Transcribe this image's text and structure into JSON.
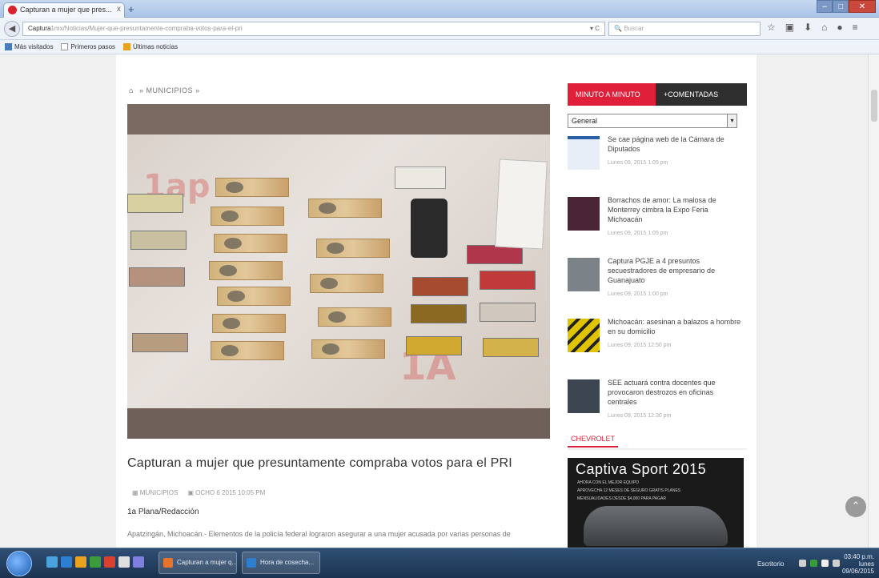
{
  "browser": {
    "tab_title": "Capturan a mujer que pres...",
    "tab_close": "x",
    "new_tab": "+",
    "window_controls": {
      "minimize": "–",
      "maximize": "□",
      "close": "✕"
    },
    "url_domain": "Captura",
    "url_rest": "1mx/Noticias/Mujer-que-presuntamente-compraba-votos-para-el-pri",
    "url_controls": "▾ C",
    "search_placeholder": "Buscar",
    "toolbar_icons": [
      "star-icon",
      "clipboard-icon",
      "download-icon",
      "home-icon",
      "chat-icon",
      "menu-icon"
    ],
    "bookmarks": [
      {
        "label": "Más visitados",
        "icon": "bookmark-star-icon",
        "color": "#4a7cc0"
      },
      {
        "label": "Primeros pasos",
        "icon": "page-icon",
        "color": "#ffffff"
      },
      {
        "label": "Últimas noticias",
        "icon": "rss-icon",
        "color": "#e8a21e"
      }
    ]
  },
  "page": {
    "breadcrumb": {
      "home": "⌂",
      "trail": "» MUNICIPIOS »"
    },
    "article": {
      "title": "Capturan a mujer que presuntamente compraba votos para el PRI",
      "meta_category": "MUNICIPIOS",
      "meta_date": "OCHO 6 2015 10:05 PM",
      "author": "1a Plana/Redacción",
      "body": "Apatzingán, Michoacán.- Elementos de la policía federal lograron asegurar a una mujer acusada por varias personas de"
    },
    "watermark": "1A",
    "watermark2": "1ap",
    "sidebar": {
      "tab_active": "MINUTO A MINUTO",
      "tab_inactive": "+COMENTADAS",
      "select_value": "General",
      "select_arrow": "▾",
      "news": [
        {
          "title": "Se cae página web de la Cámara de Diputados",
          "date": "Lunes 09, 2015 1:05 pm",
          "thumb": "#e8eef7"
        },
        {
          "title": "Borrachos de amor: La malosa de Monterrey cimbra la Expo Feria Michoacán",
          "date": "Lunes 09, 2015 1:05 pm",
          "thumb": "#4a2536"
        },
        {
          "title": "Captura PGJE a 4 presuntos secuestradores de empresario de Guanajuato",
          "date": "Lunes 09, 2015 1:00 pm",
          "thumb": "#7b8288"
        },
        {
          "title": "Michoacán: asesinan a balazos a hombre en su domicilio",
          "date": "Lunes 09, 2015 12:50 pm",
          "thumb": "#c7b300"
        },
        {
          "title": "SEE actuará contra docentes que provocaron destrozos en oficinas centrales",
          "date": "Lunes 09, 2015 12:30 pm",
          "thumb": "#3d4650"
        }
      ]
    },
    "sponsor_section": "CHEVROLET",
    "ad": {
      "title": "Captiva Sport 2015",
      "line1": "AHORA CON EL MEJOR EQUIPO",
      "line2": "APROVECHA 12 MESES DE SEGURO GRATIS PLANES",
      "line3": "MENSUALIDADES DESDE $4,000 PARA PAGAR"
    },
    "scroll_top": "⌃"
  },
  "taskbar": {
    "start": "",
    "quicklaunch_colors": [
      "#4aa3df",
      "#2f7fd1",
      "#e8a21e",
      "#3a9c3a",
      "#d9402f",
      "#e0e0e0",
      "#7f7fdf"
    ],
    "items": [
      {
        "label": "Capturan a mujer q...",
        "icon_color": "#e8732a"
      },
      {
        "label": "Hora de cosecha...",
        "icon_color": "#2f7fd1"
      }
    ],
    "tray_desk": "Escritorio",
    "tray_icons_colors": [
      "#d0d0d0",
      "#3a9c3a",
      "#f0f0f0",
      "#cfcfcf"
    ],
    "clock_time": "03:40 p.m.",
    "clock_day": "lunes",
    "clock_date": "09/06/2015"
  }
}
